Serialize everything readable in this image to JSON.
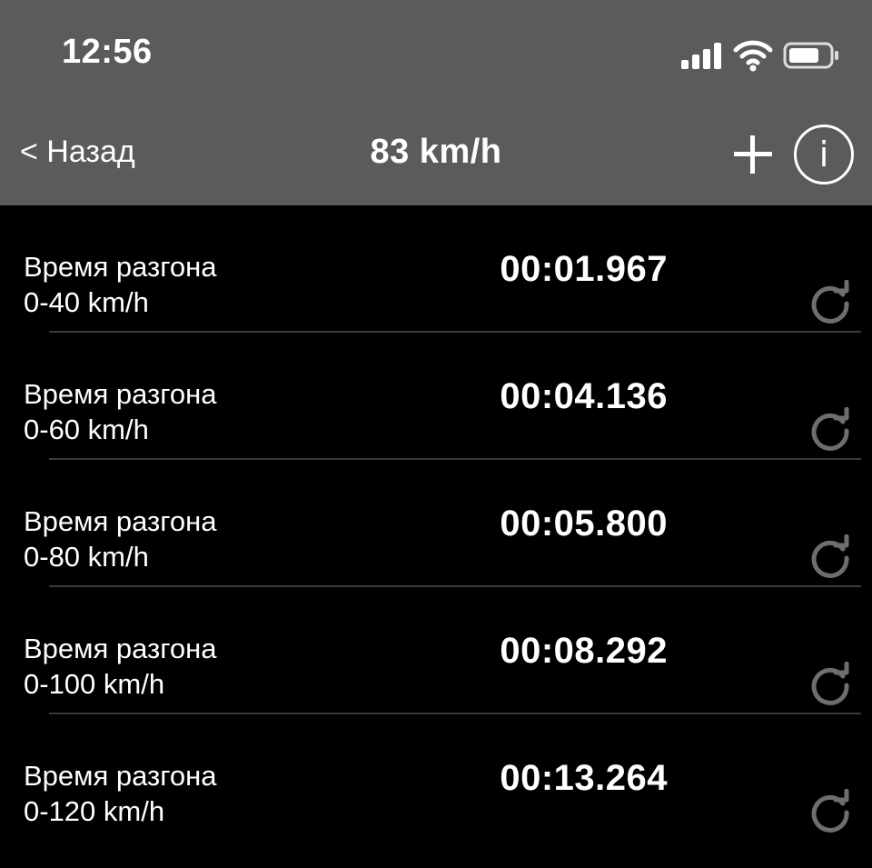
{
  "status_bar": {
    "time": "12:56",
    "icons": [
      "signal-icon",
      "wifi-icon",
      "battery-icon"
    ]
  },
  "nav": {
    "back_label": "< Назад",
    "title": "83 km/h",
    "add_icon": "plus-icon",
    "info_icon": "info-icon",
    "info_glyph": "i"
  },
  "rows": [
    {
      "label": "Время разгона",
      "range": "0-40 km/h",
      "time": "00:01.967"
    },
    {
      "label": "Время разгона",
      "range": "0-60 km/h",
      "time": "00:04.136"
    },
    {
      "label": "Время разгона",
      "range": "0-80 km/h",
      "time": "00:05.800"
    },
    {
      "label": "Время разгона",
      "range": "0-100 km/h",
      "time": "00:08.292"
    },
    {
      "label": "Время разгона",
      "range": "0-120 km/h",
      "time": "00:13.264"
    }
  ],
  "colors": {
    "header_bg": "#5b5b5b",
    "background": "#000000",
    "text": "#ffffff",
    "refresh_icon": "#6e6e6e",
    "divider": "#3a3a3a"
  }
}
